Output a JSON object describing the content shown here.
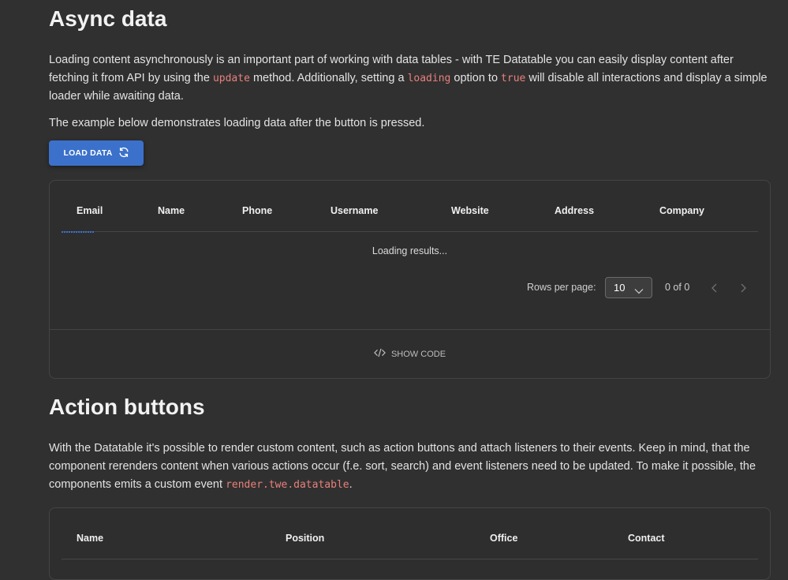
{
  "async": {
    "title": "Async data",
    "p1": {
      "t1": "Loading content asynchronously is an important part of working with data tables - with TE Datatable you can easily display content after fetching it from API by using the ",
      "c1": "update",
      "t2": " method. Additionally, setting a ",
      "c2": "loading",
      "t3": " option to ",
      "c3": "true",
      "t4": " will disable all interactions and display a simple loader while awaiting data."
    },
    "p2": "The example below demonstrates loading data after the button is pressed.",
    "load_button": "LOAD DATA",
    "columns": [
      "Email",
      "Name",
      "Phone",
      "Username",
      "Website",
      "Address",
      "Company"
    ],
    "loading_text": "Loading results...",
    "rows_per_page_label": "Rows per page:",
    "rows_per_page_value": "10",
    "page_info": "0 of 0",
    "show_code": "SHOW CODE",
    "accent": "#3b71ca"
  },
  "actions": {
    "title": "Action buttons",
    "p1": {
      "t1": "With the Datatable it's possible to render custom content, such as action buttons and attach listeners to their events. Keep in mind, that the component rerenders content when various actions occur (f.e. sort, search) and event listeners need to be updated. To make it possible, the components emits a custom event ",
      "c1": "render.twe.datatable",
      "t2": "."
    },
    "columns": [
      "Name",
      "Position",
      "Office",
      "Contact"
    ]
  },
  "icons": {
    "refresh": "refresh-icon",
    "chevron_down": "chevron-down-icon",
    "prev": "chevron-left-icon",
    "next": "chevron-right-icon",
    "code": "code-icon"
  }
}
